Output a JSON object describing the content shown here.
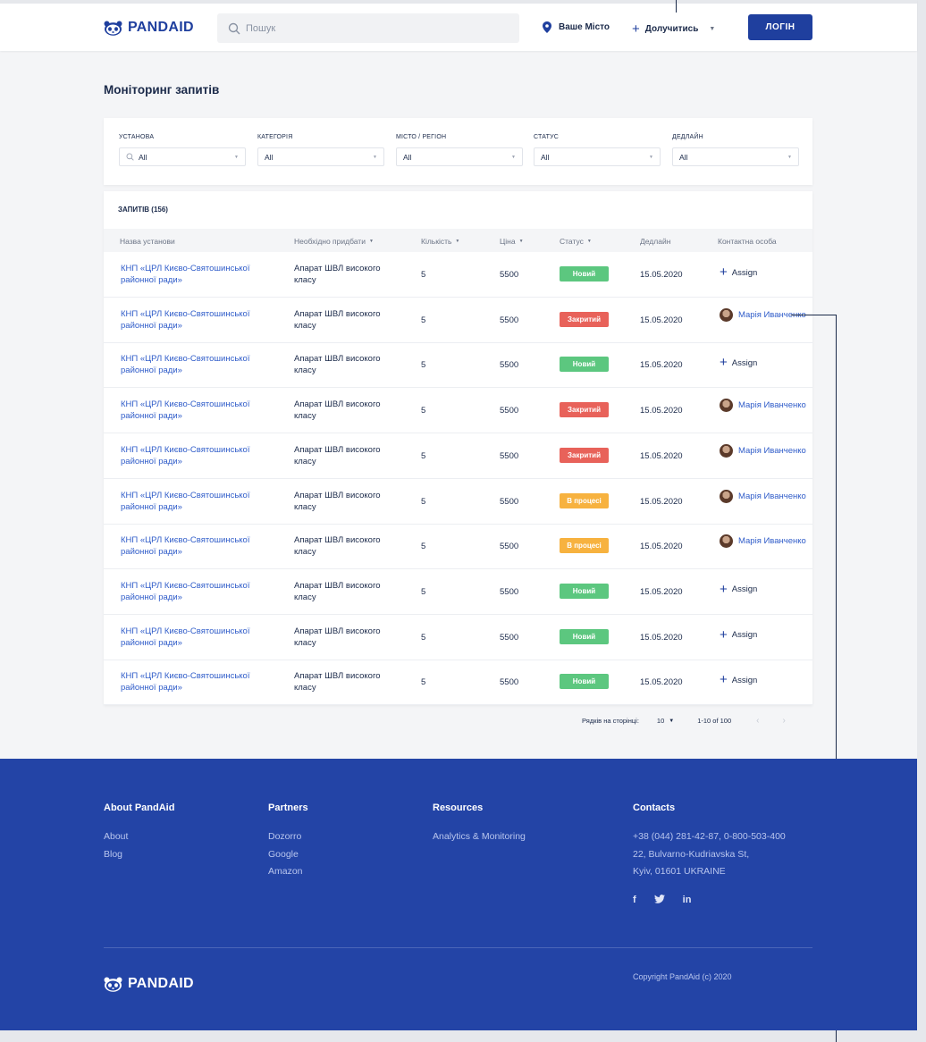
{
  "header": {
    "logo_text": "PANDAID",
    "search_placeholder": "Пошук",
    "city_label": "Ваше Місто",
    "join_label": "Долучитись",
    "login_label": "ЛОГІН"
  },
  "page_title": "Моніторинг запитів",
  "filters": [
    {
      "label": "УСТАНОВА",
      "value": "All"
    },
    {
      "label": "КАТЕГОРІЯ",
      "value": "All"
    },
    {
      "label": "МІСТО / РЕГІОН",
      "value": "All"
    },
    {
      "label": "СТАТУС",
      "value": "All"
    },
    {
      "label": "ДЕДЛАЙН",
      "value": "All"
    }
  ],
  "table": {
    "count_label": "ЗАПИТІВ (156)",
    "columns": [
      "Назва установи",
      "Необхідно придбати",
      "Кількість",
      "Ціна",
      "Статус",
      "Дедлайн",
      "Контактна особа"
    ],
    "rows": [
      {
        "inst": "КНП «ЦРЛ Києво-Святошинської районної ради»",
        "need": "Апарат ШВЛ високого класу",
        "qty": "5",
        "price": "5500",
        "status": "Новий",
        "status_type": "new",
        "deadline": "15.05.2020",
        "contact": "Assign"
      },
      {
        "inst": "КНП «ЦРЛ Києво-Святошинської районної ради»",
        "need": "Апарат ШВЛ високого класу",
        "qty": "5",
        "price": "5500",
        "status": "Закритий",
        "status_type": "closed",
        "deadline": "15.05.2020",
        "contact": "Марія Иванченко"
      },
      {
        "inst": "КНП «ЦРЛ Києво-Святошинської районної ради»",
        "need": "Апарат ШВЛ високого класу",
        "qty": "5",
        "price": "5500",
        "status": "Новий",
        "status_type": "new",
        "deadline": "15.05.2020",
        "contact": "Assign"
      },
      {
        "inst": "КНП «ЦРЛ Києво-Святошинської районної ради»",
        "need": "Апарат ШВЛ високого класу",
        "qty": "5",
        "price": "5500",
        "status": "Закритий",
        "status_type": "closed",
        "deadline": "15.05.2020",
        "contact": "Марія Иванченко"
      },
      {
        "inst": "КНП «ЦРЛ Києво-Святошинської районної ради»",
        "need": "Апарат ШВЛ високого класу",
        "qty": "5",
        "price": "5500",
        "status": "Закритий",
        "status_type": "closed",
        "deadline": "15.05.2020",
        "contact": "Марія Иванченко"
      },
      {
        "inst": "КНП «ЦРЛ Києво-Святошинської районної ради»",
        "need": "Апарат ШВЛ високого класу",
        "qty": "5",
        "price": "5500",
        "status": "В процесі",
        "status_type": "proc",
        "deadline": "15.05.2020",
        "contact": "Марія Иванченко"
      },
      {
        "inst": "КНП «ЦРЛ Києво-Святошинської районної ради»",
        "need": "Апарат ШВЛ високого класу",
        "qty": "5",
        "price": "5500",
        "status": "В процесі",
        "status_type": "proc",
        "deadline": "15.05.2020",
        "contact": "Марія Иванченко"
      },
      {
        "inst": "КНП «ЦРЛ Києво-Святошинської районної ради»",
        "need": "Апарат ШВЛ високого класу",
        "qty": "5",
        "price": "5500",
        "status": "Новий",
        "status_type": "new",
        "deadline": "15.05.2020",
        "contact": "Assign"
      },
      {
        "inst": "КНП «ЦРЛ Києво-Святошинської районної ради»",
        "need": "Апарат ШВЛ високого класу",
        "qty": "5",
        "price": "5500",
        "status": "Новий",
        "status_type": "new",
        "deadline": "15.05.2020",
        "contact": "Assign"
      },
      {
        "inst": "КНП «ЦРЛ Києво-Святошинської районної ради»",
        "need": "Апарат ШВЛ високого класу",
        "qty": "5",
        "price": "5500",
        "status": "Новий",
        "status_type": "new",
        "deadline": "15.05.2020",
        "contact": "Assign"
      }
    ]
  },
  "pagination": {
    "rows_per_page_label": "Рядків на сторінці:",
    "rows_per_page": "10",
    "range": "1-10 of 100"
  },
  "footer": {
    "about": {
      "title": "About PandAid",
      "links": [
        "About",
        "Blog"
      ]
    },
    "partners": {
      "title": "Partners",
      "links": [
        "Dozorro",
        "Google",
        "Amazon"
      ]
    },
    "resources": {
      "title": "Resources",
      "links": [
        "Analytics & Monitoring"
      ]
    },
    "contacts": {
      "title": "Contacts",
      "lines": [
        "+38 (044) 281-42-87, 0-800-503-400",
        "22, Bulvarno-Kudriavska St,",
        "Kyiv, 01601 UKRAINE"
      ]
    },
    "social": [
      "f",
      "twitter-icon",
      "in"
    ],
    "logo_text": "PANDAID",
    "copyright": "Copyright PandAid (c) 2020"
  },
  "colors": {
    "brand": "#1f3f9e",
    "footer_bg": "#2344a6",
    "new": "#5cc77f",
    "closed": "#e8625a",
    "in_progress": "#f7b23f"
  }
}
